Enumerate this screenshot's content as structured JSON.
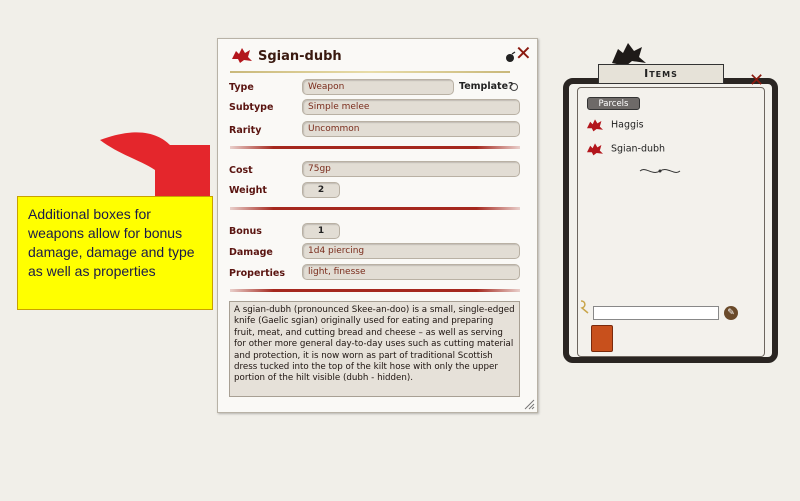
{
  "callout": {
    "text": "Additional boxes for weapons allow for bonus damage, damage and type as well as properties"
  },
  "record": {
    "title": "Sgian-dubh",
    "fields": {
      "type_label": "Type",
      "type_value": "Weapon",
      "template_label": "Template?",
      "subtype_label": "Subtype",
      "subtype_value": "Simple melee",
      "rarity_label": "Rarity",
      "rarity_value": "Uncommon",
      "cost_label": "Cost",
      "cost_value": "75gp",
      "weight_label": "Weight",
      "weight_value": "2",
      "bonus_label": "Bonus",
      "bonus_value": "1",
      "damage_label": "Damage",
      "damage_value": "1d4 piercing",
      "properties_label": "Properties",
      "properties_value": "light, finesse"
    },
    "description": "A sgian-dubh (pronounced Skee-an-doo)  is a small, single-edged knife (Gaelic sgian) originally used for eating and preparing fruit, meat, and cutting bread and cheese – as well as serving for other more general day-to-day uses such as cutting material and protection, it is now worn as part of traditional Scottish dress tucked into the top of the kilt hose with only the upper portion of the hilt visible (dubh - hidden)."
  },
  "items_window": {
    "title": "Items",
    "parcels_label": "Parcels",
    "list": [
      "Haggis",
      "Sgian-dubh"
    ]
  },
  "colors": {
    "accent_red": "#a5281e",
    "callout_yellow": "#ffff00"
  },
  "icons": [
    "dragon-icon",
    "bomb-icon",
    "close-icon",
    "edit-icon",
    "tag-icon"
  ]
}
